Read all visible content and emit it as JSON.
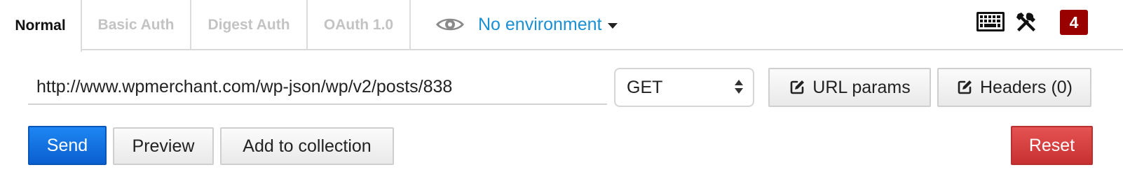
{
  "tabs": [
    {
      "label": "Normal",
      "active": true
    },
    {
      "label": "Basic Auth",
      "active": false
    },
    {
      "label": "Digest Auth",
      "active": false
    },
    {
      "label": "OAuth 1.0",
      "active": false
    }
  ],
  "environment": {
    "icon": "eye-icon",
    "selected": "No environment"
  },
  "toolbar": {
    "keyboard_icon": "keyboard-icon",
    "tools_icon": "wrench-screwdriver-icon",
    "badge_count": "4",
    "badge_color": "#990000"
  },
  "request": {
    "url": "http://www.wpmerchant.com/wp-json/wp/v2/posts/838",
    "method": "GET",
    "url_params_label": "URL params",
    "headers_label": "Headers (0)"
  },
  "actions": {
    "send_label": "Send",
    "preview_label": "Preview",
    "add_to_collection_label": "Add to collection",
    "reset_label": "Reset"
  },
  "colors": {
    "accent": "#1a8fd1",
    "send": "#0a5fcf",
    "reset": "#c73030"
  }
}
